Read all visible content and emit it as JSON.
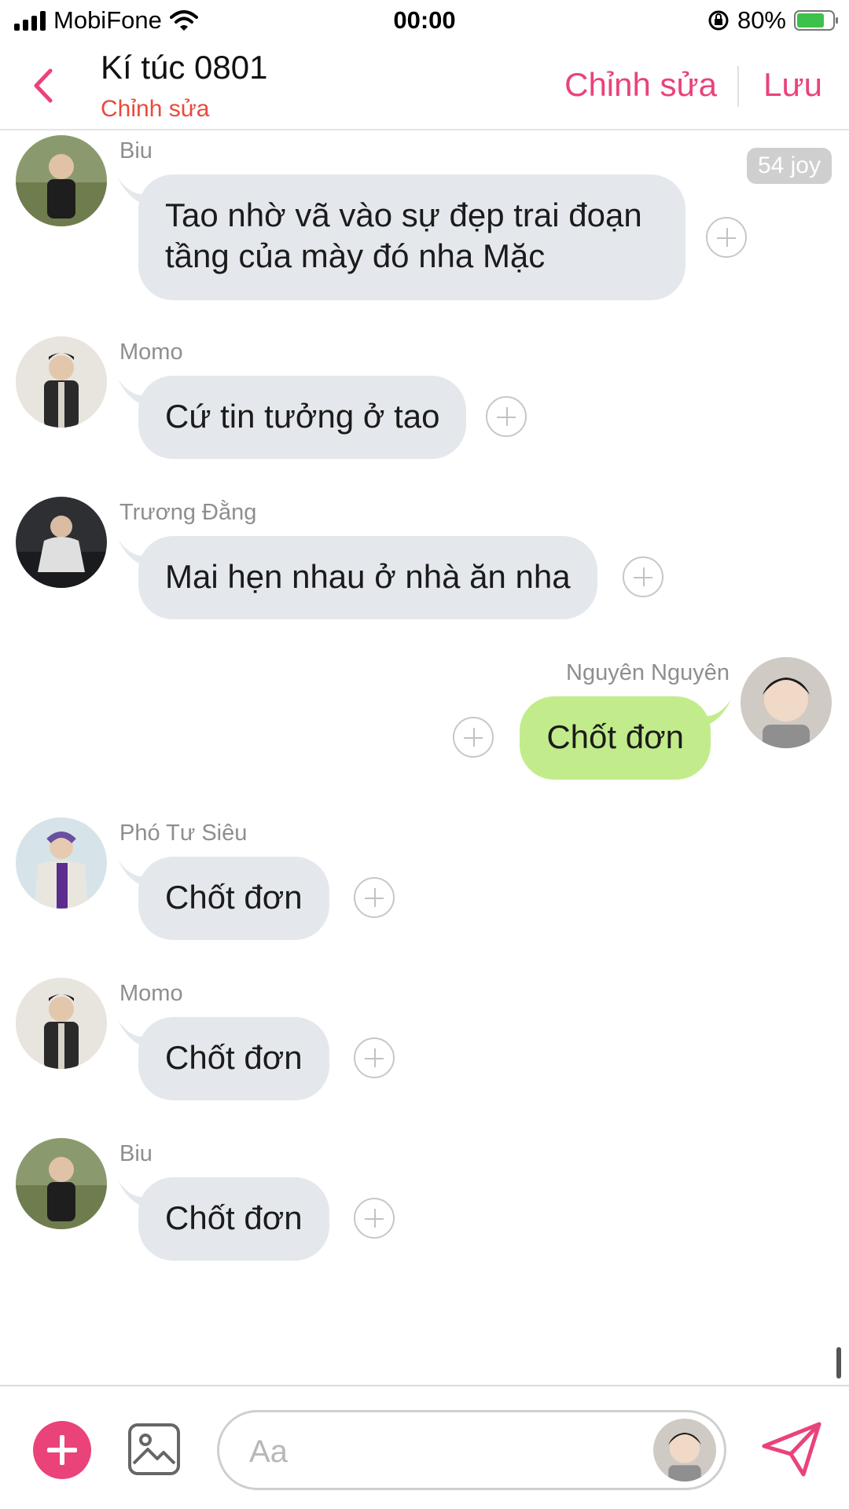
{
  "status_bar": {
    "carrier": "MobiFone",
    "time": "00:00",
    "battery": "80%"
  },
  "header": {
    "title": "Kí túc 0801",
    "subtitle": "Chỉnh sửa",
    "edit_label": "Chỉnh sửa",
    "save_label": "Lưu"
  },
  "joy_badge": "54 joy",
  "messages": [
    {
      "sender": "Biu",
      "text_line1": "Tao nhờ vã vào sự đẹp trai đoạn",
      "text_line2": "tầng của mày đó nha Mặc",
      "direction": "incoming"
    },
    {
      "sender": "Momo",
      "text": "Cứ tin tưởng ở tao",
      "direction": "incoming"
    },
    {
      "sender": "Trương Đằng",
      "text": "Mai hẹn nhau ở nhà ăn nha",
      "direction": "incoming"
    },
    {
      "sender": "Nguyên Nguyên",
      "text": "Chốt đơn",
      "direction": "outgoing"
    },
    {
      "sender": "Phó Tư Siêu",
      "text": "Chốt đơn",
      "direction": "incoming"
    },
    {
      "sender": "Momo",
      "text": "Chốt đơn",
      "direction": "incoming"
    },
    {
      "sender": "Biu",
      "text": "Chốt đơn",
      "direction": "incoming"
    }
  ],
  "input": {
    "placeholder": "Aa",
    "value": ""
  },
  "icons": {
    "back": "chevron-left-icon",
    "add": "plus-circle-icon",
    "image": "image-icon",
    "send": "paper-plane-icon"
  },
  "colors": {
    "accent": "#e9437a",
    "subtitle": "#e84b3c",
    "incoming_bubble": "#e4e8ed",
    "outgoing_bubble": "#c2ec8c"
  }
}
